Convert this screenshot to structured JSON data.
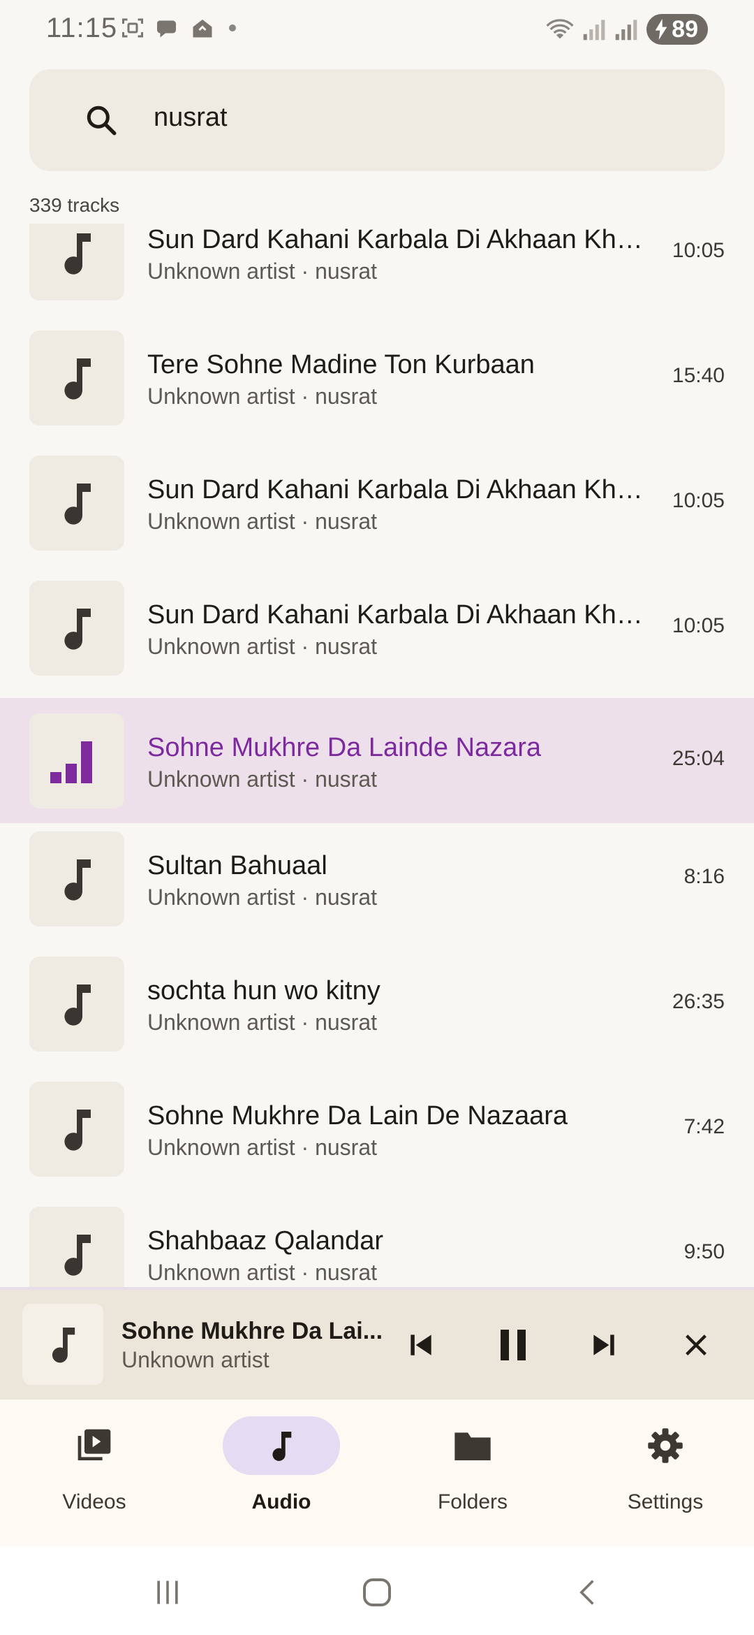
{
  "status": {
    "time": "11:15",
    "battery": "89"
  },
  "search": {
    "query": "nusrat"
  },
  "list": {
    "count": "339 tracks",
    "tracks": [
      {
        "title": "Sun Dard Kahani Karbala Di Akhaan Kho…",
        "subtitle": "Unknown artist · nusrat",
        "duration": "10:05"
      },
      {
        "title": "Tere Sohne Madine Ton Kurbaan",
        "subtitle": "Unknown artist · nusrat",
        "duration": "15:40"
      },
      {
        "title": "Sun Dard Kahani Karbala Di Akhaan Kho…",
        "subtitle": "Unknown artist · nusrat",
        "duration": "10:05"
      },
      {
        "title": "Sun Dard Kahani Karbala Di Akhaan Kho…",
        "subtitle": "Unknown artist · nusrat",
        "duration": "10:05"
      },
      {
        "title": "Sohne Mukhre Da Lainde Nazara",
        "subtitle": "Unknown artist · nusrat",
        "duration": "25:04"
      },
      {
        "title": "Sultan Bahuaal",
        "subtitle": "Unknown artist · nusrat",
        "duration": "8:16"
      },
      {
        "title": "sochta hun wo kitny",
        "subtitle": "Unknown artist · nusrat",
        "duration": "26:35"
      },
      {
        "title": "Sohne Mukhre Da Lain De Nazaara",
        "subtitle": "Unknown artist · nusrat",
        "duration": "7:42"
      },
      {
        "title": "Shahbaaz Qalandar",
        "subtitle": "Unknown artist · nusrat",
        "duration": "9:50"
      }
    ]
  },
  "player": {
    "title": "Sohne Mukhre Da Lai...",
    "artist": "Unknown artist",
    "progress_fraction": 0.0
  },
  "nav": {
    "items": [
      {
        "label": "Videos",
        "icon": "video-library-icon"
      },
      {
        "label": "Audio",
        "icon": "music-note-icon"
      },
      {
        "label": "Folders",
        "icon": "folder-icon"
      },
      {
        "label": "Settings",
        "icon": "gear-icon"
      }
    ]
  },
  "colors": {
    "accent": "#7d2a9e",
    "active_row": "#ede0ea",
    "nav_pill": "#e5dbf2"
  }
}
